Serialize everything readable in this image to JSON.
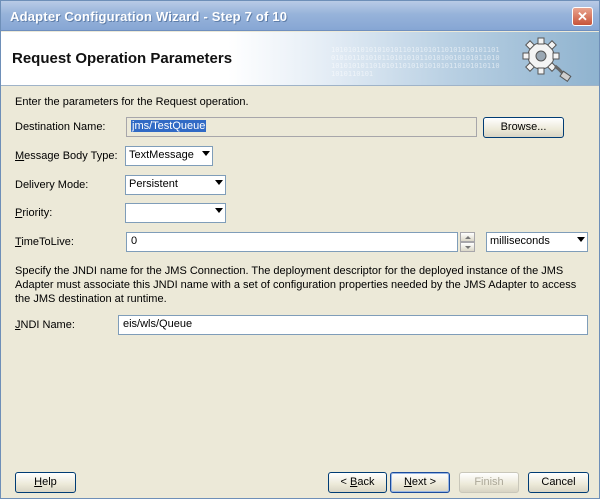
{
  "window": {
    "title": "Adapter Configuration Wizard - Step 7 of 10",
    "close_glyph": "✕"
  },
  "banner": {
    "heading": "Request Operation Parameters",
    "icon": "gear-plug-icon"
  },
  "instructions": "Enter the parameters for the Request operation.",
  "fields": {
    "destination_name": {
      "label": "Destination Name:",
      "value": "jms/TestQueue"
    },
    "browse_button": "Browse...",
    "message_body_type": {
      "label_prefix": "M",
      "label_rest": "essage Body Type:",
      "value": "TextMessage"
    },
    "delivery_mode": {
      "label": "Delivery Mode:",
      "value": "Persistent"
    },
    "priority": {
      "label_prefix": "P",
      "label_rest": "riority:",
      "value": ""
    },
    "time_to_live": {
      "label_prefix": "T",
      "label_rest": "imeToLive:",
      "value": "0",
      "unit": "milliseconds"
    }
  },
  "jndi_info": "Specify the JNDI name for the JMS Connection.  The deployment descriptor for the deployed instance of the JMS Adapter must associate this JNDI name with a set of configuration properties needed by the JMS Adapter to access the JMS destination at runtime.",
  "jndi": {
    "label_prefix": "J",
    "label_rest": "NDI Name:",
    "value": "eis/wls/Queue"
  },
  "footer": {
    "help": {
      "prefix": "H",
      "rest": "elp"
    },
    "back": {
      "pre": "< ",
      "mn": "B",
      "rest": "ack"
    },
    "next": {
      "mn": "N",
      "rest": "ext >"
    },
    "finish": "Finish",
    "cancel": "Cancel"
  },
  "colors": {
    "accent": "#316ac5",
    "titlebar": "#97b3da",
    "dialog_bg": "#ece9d8"
  }
}
